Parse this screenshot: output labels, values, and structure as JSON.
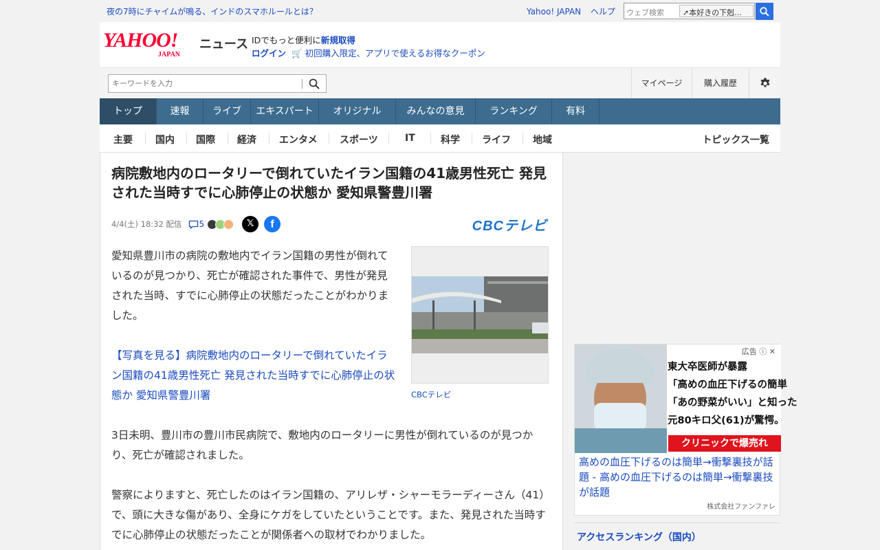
{
  "topbar": {
    "promo": "夜の7時にチャイムが鳴る、インドのスマホルールとは？",
    "links": [
      "Yahoo! JAPAN",
      "ヘルプ"
    ],
    "search_placeholder": "ウェブ検索",
    "search_suggestion": "本好きの下剋..."
  },
  "header": {
    "logo_text": "YAHOO!",
    "logo_sub": "JAPAN",
    "site_name": "ニュース",
    "id_text": "IDでもっと便利に",
    "signup": "新規取得",
    "login": "ログイン",
    "coupon": "初回購入限定、アプリで使えるお得なクーポン"
  },
  "search": {
    "placeholder": "キーワードを入力",
    "mypage": "マイページ",
    "purchase_history": "購入履歴"
  },
  "nav": {
    "items": [
      "トップ",
      "速報",
      "ライブ",
      "エキスパート",
      "オリジナル",
      "みんなの意見",
      "ランキング",
      "有料"
    ]
  },
  "subnav": {
    "items": [
      "主要",
      "国内",
      "国際",
      "経済",
      "エンタメ",
      "スポーツ",
      "IT",
      "科学",
      "ライフ",
      "地域"
    ],
    "active": "国内",
    "topics": "トピックス一覧"
  },
  "article": {
    "title": "病院敷地内のロータリーで倒れていたイラン国籍の41歳男性死亡 発見された当時すでに心肺停止の状態か 愛知県警豊川署",
    "date": "4/4(土) 18:32",
    "delivered": "配信",
    "comment_count": "5",
    "source": "CBCテレビ",
    "source_logo": "CBCテレビ",
    "para1": "愛知県豊川市の病院の敷地内でイラン国籍の男性が倒れているのが見つかり、死亡が確認された事件で、男性が発見された当時、すでに心肺停止の状態だったことがわかりました。",
    "photo_link": "【写真を見る】病院敷地内のロータリーで倒れていたイラン国籍の41歳男性死亡 発見された当時すでに心肺停止の状態か 愛知県警豊川署",
    "photo_caption": "CBCテレビ",
    "para2": "3日未明、豊川市の豊川市民病院で、敷地内のロータリーに男性が倒れているのが見つかり、死亡が確認されました。",
    "para3": "警察によりますと、死亡したのはイラン国籍の、アリレザ・シャーモラーディーさん（41）で、頭に大きな傷があり、全身にケガをしていたということです。また、発見された当時すでに心肺停止の状態だったことが関係者への取材でわかりました。"
  },
  "ad": {
    "label": "広告",
    "lines": [
      "東大卒医師が暴露",
      "「高めの血圧下げるの簡単",
      "「あの野菜がいい」と知った",
      "元80キロ父(61)が驚愕。"
    ],
    "cta": "クリニックで爆売れ",
    "text": "高めの血圧下げるのは簡単→衝撃裏技が話題 - 高めの血圧下げるのは簡単→衝撃裏技が話題",
    "advertiser": "株式会社ファンファレ"
  },
  "ranking": {
    "title": "アクセスランキング（国内）"
  }
}
